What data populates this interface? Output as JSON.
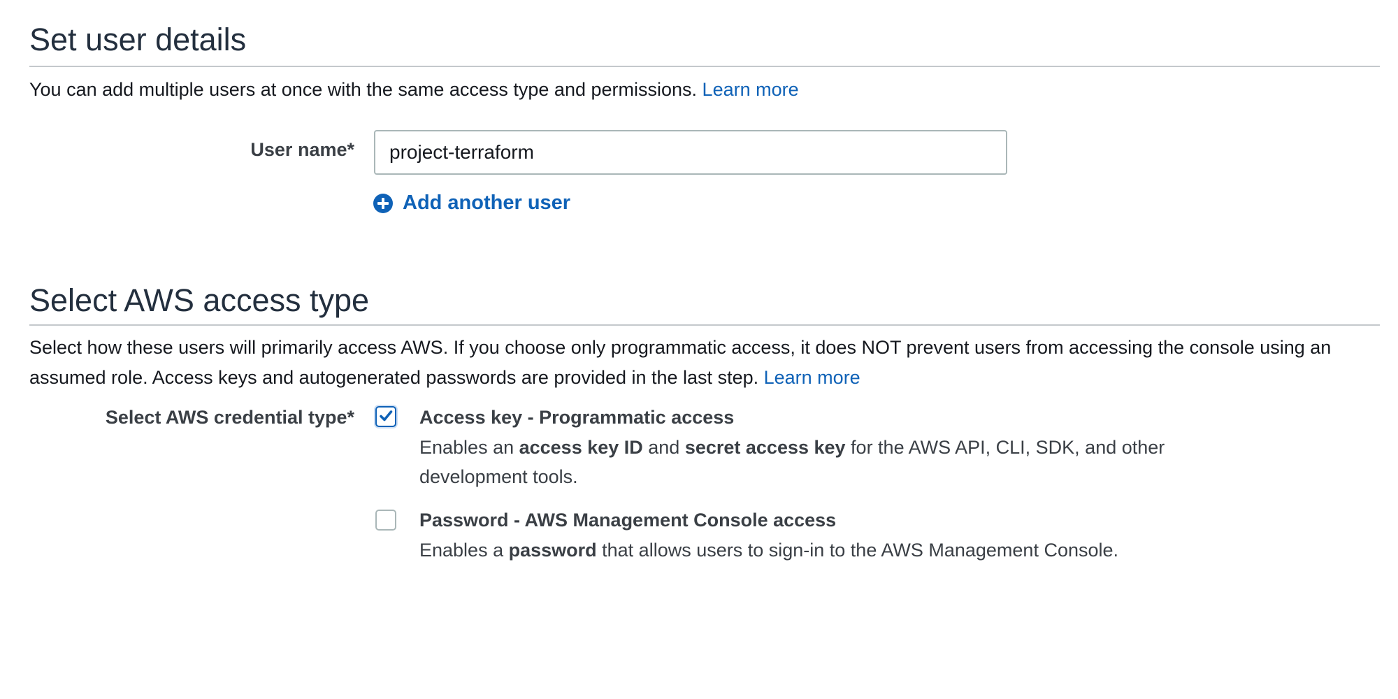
{
  "user_details": {
    "title": "Set user details",
    "description": "You can add multiple users at once with the same access type and permissions.",
    "learn_more": "Learn more",
    "username_label": "User name*",
    "username_value": "project-terraform",
    "add_user_label": "Add another user"
  },
  "access_type": {
    "title": "Select AWS access type",
    "description": "Select how these users will primarily access AWS. If you choose only programmatic access, it does NOT prevent users from accessing the console using an assumed role. Access keys and autogenerated passwords are provided in the last step.",
    "learn_more": "Learn more",
    "credential_label": "Select AWS credential type*",
    "options": [
      {
        "title": "Access key - Programmatic access",
        "checked": true,
        "desc_parts": [
          {
            "text": "Enables an ",
            "bold": false
          },
          {
            "text": "access key ID",
            "bold": true
          },
          {
            "text": " and ",
            "bold": false
          },
          {
            "text": "secret access key",
            "bold": true
          },
          {
            "text": " for the AWS API, CLI, SDK, and other development tools.",
            "bold": false
          }
        ]
      },
      {
        "title": "Password - AWS Management Console access",
        "checked": false,
        "desc_parts": [
          {
            "text": "Enables a ",
            "bold": false
          },
          {
            "text": "password",
            "bold": true
          },
          {
            "text": " that allows users to sign-in to the AWS Management Console.",
            "bold": false
          }
        ]
      }
    ]
  },
  "colors": {
    "link": "#0f62b7",
    "rule": "#c4c8cc",
    "input_border": "#aab7b8"
  },
  "icons": {
    "add_user": "plus-circle-icon",
    "checked": "checkmark-icon"
  }
}
